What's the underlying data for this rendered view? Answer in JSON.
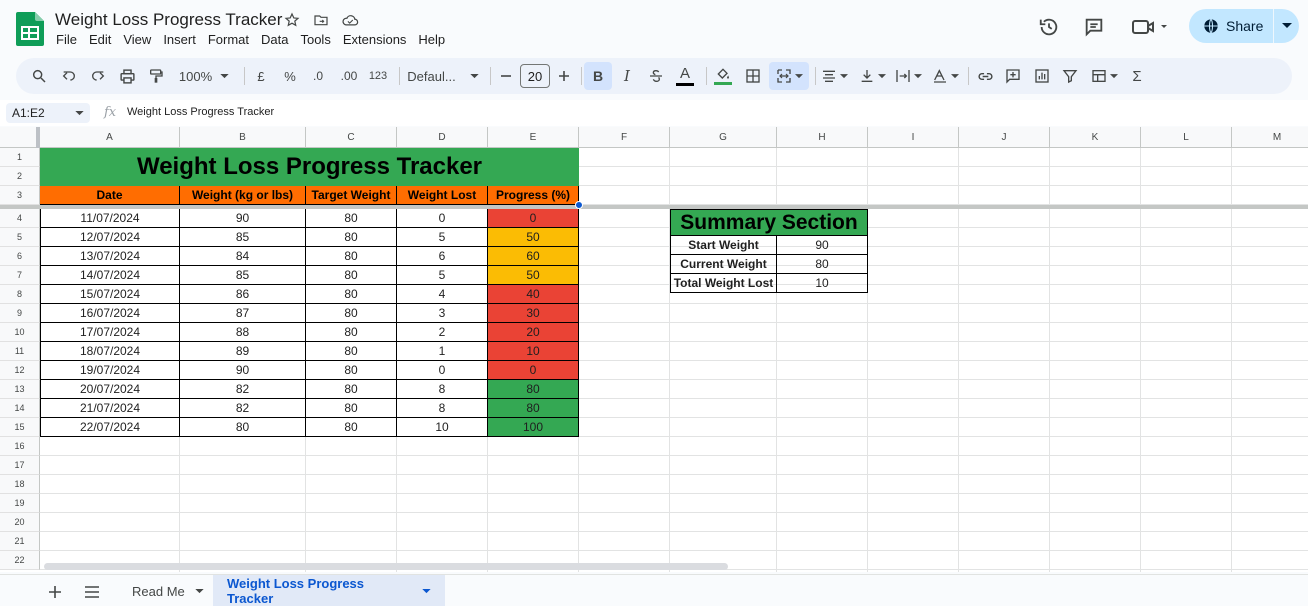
{
  "app": {
    "title": "Weight Loss Progress Tracker",
    "menu": [
      "File",
      "Edit",
      "View",
      "Insert",
      "Format",
      "Data",
      "Tools",
      "Extensions",
      "Help"
    ],
    "share_label": "Share"
  },
  "toolbar": {
    "zoom": "100%",
    "currency": "£",
    "percent": "%",
    "dec_decrease": ".0",
    "dec_increase": ".00",
    "number_format": "123",
    "font": "Defaul...",
    "font_size": "20",
    "bold": "B",
    "italic": "I",
    "strike": "S",
    "text_color": "A",
    "sum": "Σ"
  },
  "formula_bar": {
    "name_box": "A1:E2",
    "fx": "fx",
    "value": "Weight Loss Progress Tracker"
  },
  "grid": {
    "columns": [
      "A",
      "B",
      "C",
      "D",
      "E",
      "F",
      "G",
      "H",
      "I",
      "J",
      "K",
      "L",
      "M"
    ],
    "rows": [
      "1",
      "2",
      "3",
      "4",
      "5",
      "6",
      "7",
      "8",
      "9",
      "10",
      "11",
      "12",
      "13",
      "14",
      "15",
      "16",
      "17",
      "18",
      "19",
      "20",
      "21",
      "22"
    ]
  },
  "tracker": {
    "title": "Weight Loss Progress Tracker",
    "headers": [
      "Date",
      "Weight (kg or lbs)",
      "Target Weight",
      "Weight Lost",
      "Progress (%)"
    ],
    "rows": [
      [
        "11/07/2024",
        "90",
        "80",
        "0",
        "0"
      ],
      [
        "12/07/2024",
        "85",
        "80",
        "5",
        "50"
      ],
      [
        "13/07/2024",
        "84",
        "80",
        "6",
        "60"
      ],
      [
        "14/07/2024",
        "85",
        "80",
        "5",
        "50"
      ],
      [
        "15/07/2024",
        "86",
        "80",
        "4",
        "40"
      ],
      [
        "16/07/2024",
        "87",
        "80",
        "3",
        "30"
      ],
      [
        "17/07/2024",
        "88",
        "80",
        "2",
        "20"
      ],
      [
        "18/07/2024",
        "89",
        "80",
        "1",
        "10"
      ],
      [
        "19/07/2024",
        "90",
        "80",
        "0",
        "0"
      ],
      [
        "20/07/2024",
        "82",
        "80",
        "8",
        "80"
      ],
      [
        "21/07/2024",
        "82",
        "80",
        "8",
        "80"
      ],
      [
        "22/07/2024",
        "80",
        "80",
        "10",
        "100"
      ]
    ],
    "progress_colors": [
      "#ea4335",
      "#fbbc04",
      "#fbbc04",
      "#fbbc04",
      "#ea4335",
      "#ea4335",
      "#ea4335",
      "#ea4335",
      "#ea4335",
      "#34a853",
      "#34a853",
      "#34a853"
    ]
  },
  "summary": {
    "title": "Summary Section",
    "rows": [
      [
        "Start Weight",
        "90"
      ],
      [
        "Current Weight",
        "80"
      ],
      [
        "Total Weight Lost",
        "10"
      ]
    ]
  },
  "sheets": {
    "tabs": [
      "Read Me",
      "Weight Loss Progress Tracker"
    ],
    "active": 1
  },
  "colors": {
    "title_bg": "#34a853",
    "header_bg": "#ff6d01",
    "accent": "#0b57d0"
  }
}
